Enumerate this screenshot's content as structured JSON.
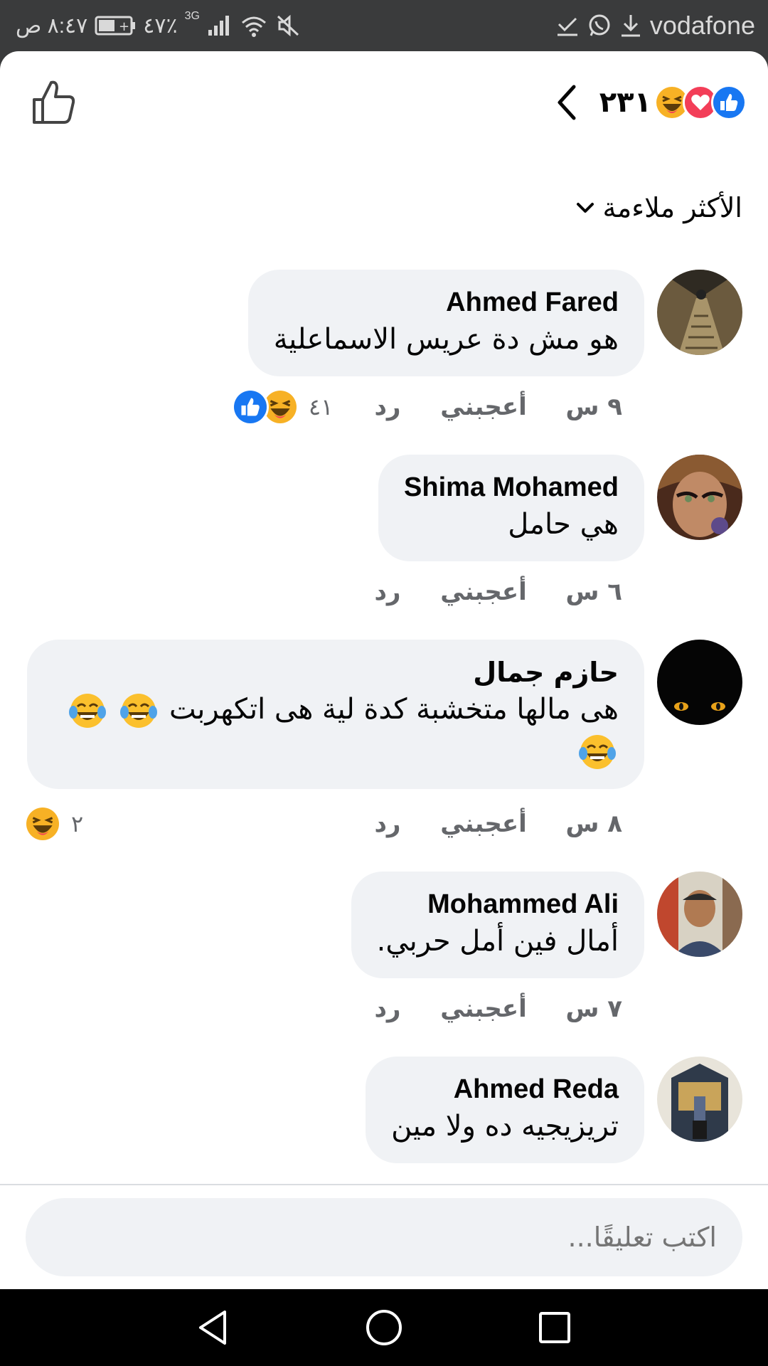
{
  "status_bar": {
    "carrier": "vodafone",
    "time": "٨:٤٧ ص",
    "battery": "٤٧٪",
    "network": "3G"
  },
  "header": {
    "reaction_count": "٢٣١",
    "reactions": [
      "like",
      "love",
      "haha"
    ]
  },
  "sort": {
    "label": "الأكثر ملاءمة"
  },
  "comments": [
    {
      "name": "Ahmed Fared",
      "text": "هو مش دة عريس الاسماعلية",
      "time": "٩ س",
      "like_label": "أعجبني",
      "reply_label": "رد",
      "reaction_count": "٤١",
      "reactions": [
        "haha",
        "like"
      ]
    },
    {
      "name": "Shima Mohamed",
      "text": "هي حامل",
      "time": "٦ س",
      "like_label": "أعجبني",
      "reply_label": "رد"
    },
    {
      "name": "حازم جمال",
      "text": "هى مالها متخشبة كدة لية هى اتكهربت",
      "time": "٨ س",
      "like_label": "أعجبني",
      "reply_label": "رد",
      "reaction_count": "٢",
      "reactions": [
        "haha"
      ]
    },
    {
      "name": "Mohammed Ali",
      "text": "أمال فين أمل حربي.",
      "time": "٧ س",
      "like_label": "أعجبني",
      "reply_label": "رد"
    },
    {
      "name": "Ahmed Reda",
      "text": "تريزيجيه ده ولا مين"
    }
  ],
  "composer": {
    "placeholder": "اكتب تعليقًا..."
  },
  "colors": {
    "like_blue": "#1877f2",
    "love_red": "#f33e58",
    "haha_yellow": "#f7b125",
    "bubble_bg": "#f0f2f5",
    "meta_gray": "#65676b"
  }
}
